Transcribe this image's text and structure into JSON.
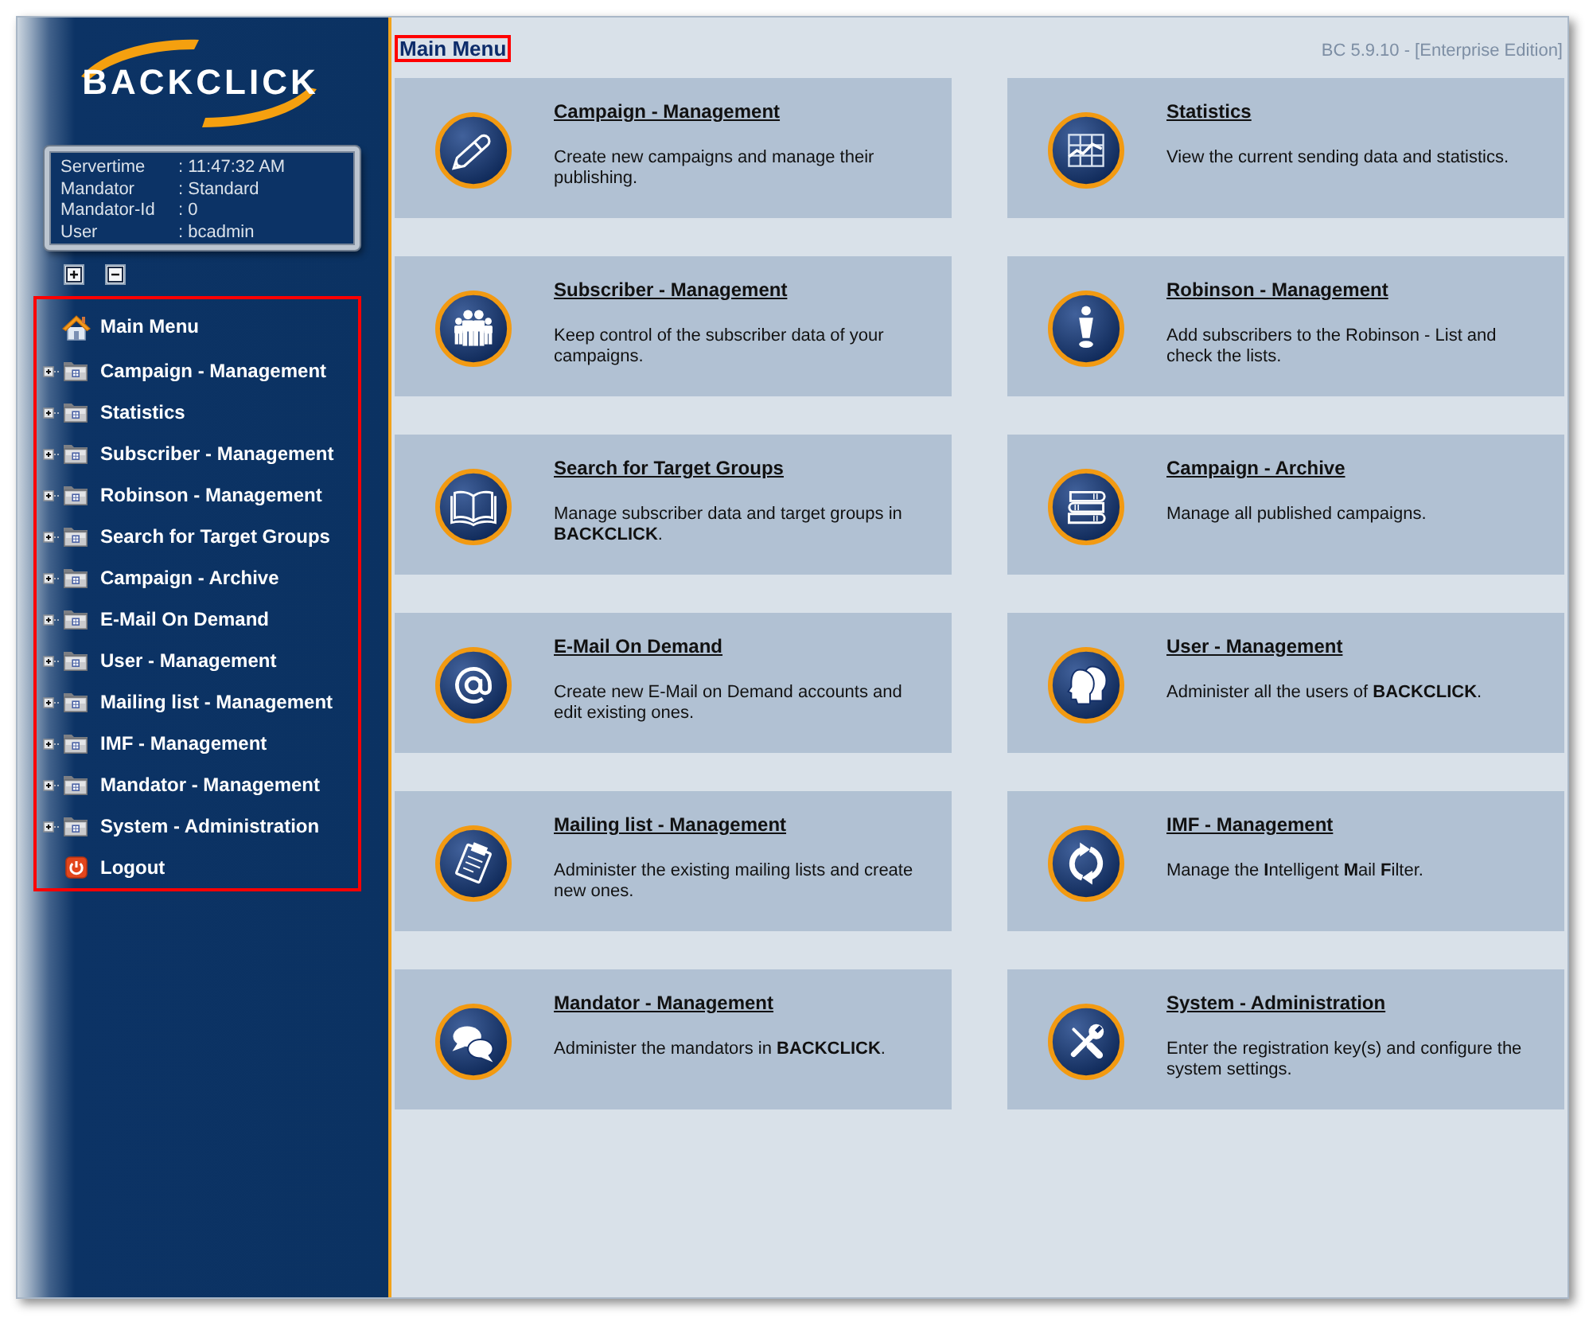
{
  "sidebar": {
    "logo": "BACKCLICK",
    "info": [
      {
        "label": "Servertime",
        "value": ": 11:47:32 AM"
      },
      {
        "label": "Mandator",
        "value": ": Standard"
      },
      {
        "label": "Mandator-Id",
        "value": ": 0"
      },
      {
        "label": "User",
        "value": ": bcadmin"
      }
    ],
    "menu": {
      "highlighted": true,
      "items": [
        {
          "kind": "home",
          "label": "Main Menu"
        },
        {
          "kind": "folder",
          "label": "Campaign - Management",
          "expanded": false
        },
        {
          "kind": "folder",
          "label": "Statistics",
          "expanded": false
        },
        {
          "kind": "folder",
          "label": "Subscriber - Management",
          "expanded": false
        },
        {
          "kind": "folder",
          "label": "Robinson - Management",
          "expanded": false
        },
        {
          "kind": "folder",
          "label": "Search for Target Groups",
          "expanded": false
        },
        {
          "kind": "folder",
          "label": "Campaign - Archive",
          "expanded": false
        },
        {
          "kind": "folder",
          "label": "E-Mail On Demand",
          "expanded": false
        },
        {
          "kind": "folder",
          "label": "User - Management",
          "expanded": false
        },
        {
          "kind": "folder",
          "label": "Mailing list - Management",
          "expanded": false
        },
        {
          "kind": "folder",
          "label": "IMF - Management",
          "expanded": false
        },
        {
          "kind": "folder",
          "label": "Mandator - Management",
          "expanded": false
        },
        {
          "kind": "folder",
          "label": "System - Administration",
          "expanded": false
        },
        {
          "kind": "logout",
          "label": "Logout"
        }
      ]
    }
  },
  "main": {
    "title": {
      "text": "Main Menu",
      "highlighted": true
    },
    "version": "BC 5.9.10 - [Enterprise Edition]",
    "cards": [
      {
        "kind": "pen",
        "title": "Campaign - Management",
        "description": "Create new campaigns and manage their publishing."
      },
      {
        "kind": "chart",
        "title": "Statistics",
        "description": "View the current sending data and statistics."
      },
      {
        "kind": "people",
        "title": "Subscriber - Management",
        "description": "Keep control of the subscriber data of your campaigns."
      },
      {
        "kind": "figure",
        "title": "Robinson - Management",
        "description": "Add subscribers to the Robinson - List and check the lists."
      },
      {
        "kind": "book",
        "title": "Search for Target Groups",
        "description": "Manage subscriber data and target groups in **BACKCLICK**."
      },
      {
        "kind": "books",
        "title": "Campaign - Archive",
        "description": "Manage all published campaigns."
      },
      {
        "kind": "at",
        "title": "E-Mail On Demand",
        "description": "Create new E-Mail on Demand accounts and edit existing ones."
      },
      {
        "kind": "heads",
        "title": "User - Management",
        "description": "Administer all the users of **BACKCLICK**."
      },
      {
        "kind": "clipboard",
        "title": "Mailing list - Management",
        "description": "Administer the existing mailing lists and create new ones."
      },
      {
        "kind": "refresh",
        "title": "IMF - Management",
        "description": "Manage the **I**ntelligent **M**ail **F**ilter."
      },
      {
        "kind": "bubbles",
        "title": "Mandator - Management",
        "description": "Administer the mandators in **BACKCLICK**."
      },
      {
        "kind": "tools",
        "title": "System - Administration",
        "description": "Enter the registration key(s) and configure the system settings."
      }
    ]
  }
}
